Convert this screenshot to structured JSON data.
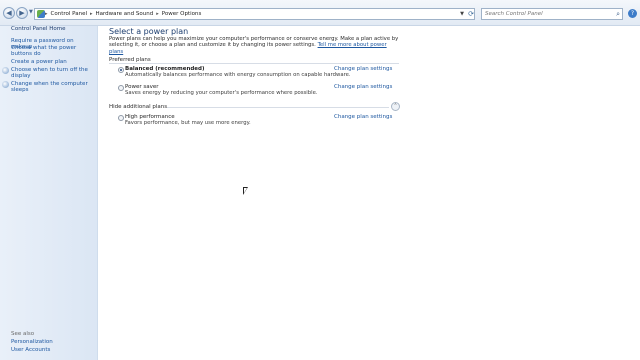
{
  "address_bar": {
    "back_glyph": "◀",
    "forward_glyph": "▶",
    "breadcrumbs": [
      "Control Panel",
      "Hardware and Sound",
      "Power Options"
    ],
    "separator": "▸",
    "search_placeholder": "Search Control Panel"
  },
  "sidebar": {
    "home": "Control Panel Home",
    "links": [
      "Require a password on wakeup",
      "Choose what the power buttons do",
      "Create a power plan",
      "Choose when to turn off the display",
      "Change when the computer sleeps"
    ],
    "see_also_heading": "See also",
    "see_also": [
      "Personalization",
      "User Accounts"
    ]
  },
  "main": {
    "title": "Select a power plan",
    "intro": "Power plans can help you maximize your computer's performance or conserve energy. Make a plan active by selecting it, or choose a plan and customize it by changing its power settings.",
    "intro_link": "Tell me more about power plans",
    "preferred_heading": "Preferred plans",
    "hidden_heading": "Hide additional plans",
    "change_link": "Change plan settings",
    "plans": [
      {
        "name": "Balanced (recommended)",
        "desc": "Automatically balances performance with energy consumption on capable hardware.",
        "selected": true
      },
      {
        "name": "Power saver",
        "desc": "Saves energy by reducing your computer's performance where possible.",
        "selected": false
      },
      {
        "name": "High performance",
        "desc": "Favors performance, but may use more energy.",
        "selected": false
      }
    ]
  }
}
